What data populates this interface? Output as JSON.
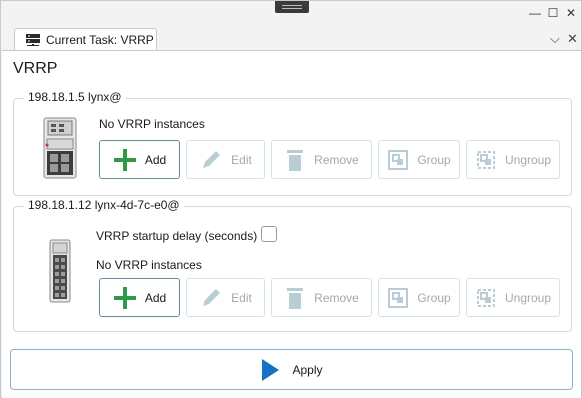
{
  "window": {
    "minimize": "—",
    "maximize": "☐",
    "close": "✕"
  },
  "tab": {
    "label": "Current Task: VRRP",
    "chevron": "⌵",
    "close": "✕"
  },
  "page": {
    "title": "VRRP"
  },
  "groups": [
    {
      "legend": "198.18.1.5 lynx@",
      "status": "No VRRP instances",
      "buttons": {
        "add": "Add",
        "edit": "Edit",
        "remove": "Remove",
        "group": "Group",
        "ungroup": "Ungroup"
      }
    },
    {
      "legend": "198.18.1.12 lynx-4d-7c-e0@",
      "startup_delay_label": "VRRP startup delay (seconds)",
      "startup_delay_checked": false,
      "status": "No VRRP instances",
      "buttons": {
        "add": "Add",
        "edit": "Edit",
        "remove": "Remove",
        "group": "Group",
        "ungroup": "Ungroup"
      }
    }
  ],
  "apply": {
    "label": "Apply"
  },
  "colors": {
    "add_green": "#2e9a49",
    "apply_blue": "#1473c5",
    "disabled_icon": "#b9cdd4"
  }
}
